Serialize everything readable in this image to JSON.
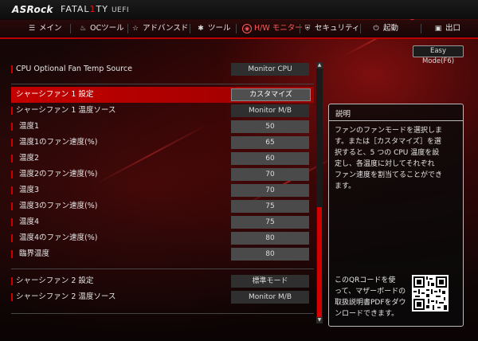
{
  "header": {
    "brand": "ASRock",
    "series_prefix": "FATAL",
    "series_mid": "1",
    "series_suffix": "TY",
    "uefi": "UEFI"
  },
  "nav": {
    "tabs": [
      {
        "label": "メイン",
        "icon": "list-icon"
      },
      {
        "label": "OCツール",
        "icon": "flame-icon"
      },
      {
        "label": "アドバンスド",
        "icon": "star-icon"
      },
      {
        "label": "ツール",
        "icon": "wrench-icon"
      },
      {
        "label": "H/W モニター",
        "icon": "monitor-icon",
        "active": true
      },
      {
        "label": "セキュリティ",
        "icon": "shield-icon"
      },
      {
        "label": "起動",
        "icon": "power-icon"
      },
      {
        "label": "出口",
        "icon": "exit-icon"
      }
    ]
  },
  "easy_mode": "Easy Mode(F6)",
  "settings": {
    "top": {
      "label": "CPU Optional Fan Temp Source",
      "value": "Monitor CPU"
    },
    "fan1_setting": {
      "label": "シャーシファン 1 設定",
      "value": "カスタマイズ"
    },
    "fan1_source": {
      "label": "シャーシファン 1 温度ソース",
      "value": "Monitor M/B"
    },
    "items": [
      {
        "label": "温度1",
        "value": "50"
      },
      {
        "label": "温度1のファン速度(%)",
        "value": "65"
      },
      {
        "label": "温度2",
        "value": "60"
      },
      {
        "label": "温度2のファン速度(%)",
        "value": "70"
      },
      {
        "label": "温度3",
        "value": "70"
      },
      {
        "label": "温度3のファン速度(%)",
        "value": "75"
      },
      {
        "label": "温度4",
        "value": "75"
      },
      {
        "label": "温度4のファン速度(%)",
        "value": "80"
      },
      {
        "label": "臨界温度",
        "value": "80"
      }
    ],
    "fan2_setting": {
      "label": "シャーシファン 2 設定",
      "value": "標準モード"
    },
    "fan2_source": {
      "label": "シャーシファン 2 温度ソース",
      "value": "Monitor M/B"
    }
  },
  "description": {
    "title": "説明",
    "lines": [
      "ファンのファンモードを選択しま",
      "す。または［カスタマイズ］を選",
      "択すると、5 つの CPU 温度を設",
      "定し、各温度に対してそれぞれ",
      "ファン速度を割当てることができ",
      "ます。"
    ],
    "qr_lines": [
      "このQRコードを使",
      "って、マザーボードの",
      "取扱説明書PDFをダウ",
      "ンロードできます。"
    ]
  }
}
